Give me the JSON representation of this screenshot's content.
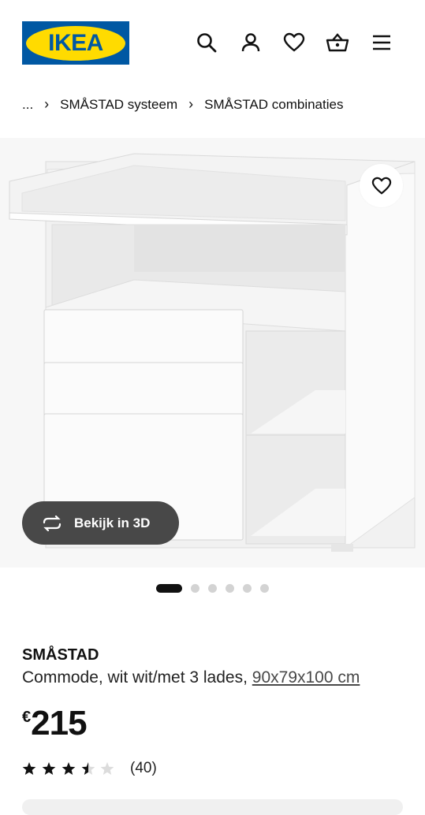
{
  "header": {
    "logo_text": "IKEA",
    "icons": [
      "search-icon",
      "user-icon",
      "heart-icon",
      "basket-icon",
      "menu-icon"
    ]
  },
  "breadcrumb": {
    "items": [
      "...",
      "SMÅSTAD systeem",
      "SMÅSTAD combinaties"
    ]
  },
  "gallery": {
    "view3d_label": "Bekijk in 3D",
    "dots": 6,
    "active_dot": 0
  },
  "product": {
    "name": "SMÅSTAD",
    "description": "Commode, wit wit/met 3 lades,",
    "dimensions": "90x79x100 cm",
    "currency": "€",
    "price": "215",
    "rating_value": 3.5,
    "rating_max": 5,
    "reviews": "(40)"
  },
  "colors": {
    "brand_blue": "#0058a3",
    "brand_yellow": "#ffdb00"
  }
}
